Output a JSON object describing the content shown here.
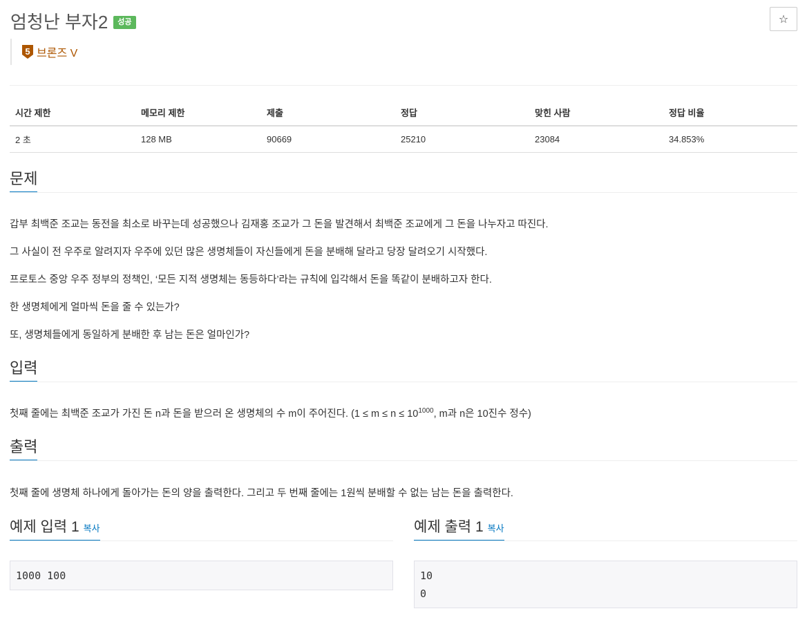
{
  "problem": {
    "title": "엄청난 부자2",
    "status_badge": "성공",
    "star_icon": "☆",
    "tier": {
      "number": "5",
      "label": "브론즈 V",
      "color": "#ad5600"
    }
  },
  "info_table": {
    "headers": [
      "시간 제한",
      "메모리 제한",
      "제출",
      "정답",
      "맞힌 사람",
      "정답 비율"
    ],
    "values": [
      "2 초",
      "128 MB",
      "90669",
      "25210",
      "23084",
      "34.853%"
    ]
  },
  "sections": {
    "problem_title": "문제",
    "problem_lines": [
      "갑부 최백준 조교는 동전을 최소로 바꾸는데 성공했으나 김재홍 조교가 그 돈을 발견해서 최백준 조교에게 그 돈을 나누자고 따진다.",
      "그 사실이 전 우주로 알려지자 우주에 있던 많은 생명체들이 자신들에게 돈을 분배해 달라고 당장 달려오기 시작했다.",
      "프로토스 중앙 우주 정부의 정책인, ‘모든 지적 생명체는 동등하다’라는 규칙에 입각해서 돈을 똑같이 분배하고자 한다.",
      "한 생명체에게 얼마씩 돈을 줄 수 있는가?",
      "또, 생명체들에게 동일하게 분배한 후 남는 돈은 얼마인가?"
    ],
    "input_title": "입력",
    "input_text_before": "첫째 줄에는 최백준 조교가 가진 돈 n과 돈을 받으러 온 생명체의 수 m이 주어진다. (1 ≤ m ≤ n ≤ 10",
    "input_sup": "1000",
    "input_text_after": ", m과 n은 10진수 정수)",
    "output_title": "출력",
    "output_text": "첫째 줄에 생명체 하나에게 돌아가는 돈의 양을 출력한다. 그리고 두 번째 줄에는 1원씩 분배할 수 없는 남는 돈을 출력한다."
  },
  "samples": {
    "input_title": "예제 입력 1",
    "output_title": "예제 출력 1",
    "copy_label": "복사",
    "input_value": "1000 100",
    "output_value": "10\n0"
  }
}
